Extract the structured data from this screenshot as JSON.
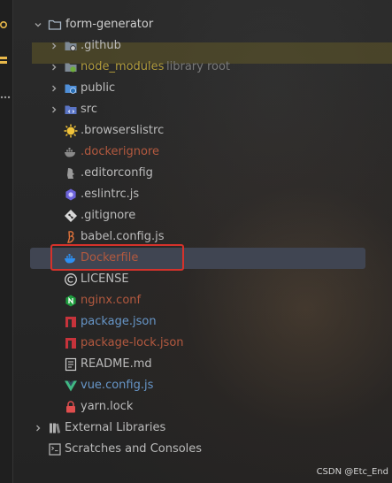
{
  "tree": {
    "root": {
      "label": "form-generator"
    },
    "items": [
      {
        "label": "",
        "detail": ""
      },
      {
        "label": ".github"
      },
      {
        "label": "node_modules",
        "detail": "library root"
      },
      {
        "label": "public"
      },
      {
        "label": "src"
      },
      {
        "label": ".browserslistrc"
      },
      {
        "label": ".dockerignore"
      },
      {
        "label": ".editorconfig"
      },
      {
        "label": ".eslintrc.js"
      },
      {
        "label": ".gitignore"
      },
      {
        "label": "babel.config.js"
      },
      {
        "label": "Dockerfile"
      },
      {
        "label": "LICENSE"
      },
      {
        "label": "nginx.conf"
      },
      {
        "label": "package.json"
      },
      {
        "label": "package-lock.json"
      },
      {
        "label": "README.md"
      },
      {
        "label": "vue.config.js"
      },
      {
        "label": "yarn.lock"
      },
      {
        "label": "External Libraries"
      },
      {
        "label": "Scratches and Consoles"
      }
    ]
  },
  "colors": {
    "default_text": "#bbbbbb",
    "ignored_text": "#b3593f",
    "modified_text": "#6796c8",
    "library_text": "#b39d3a",
    "selected_row": "#404552",
    "highlight_box": "#d6322b"
  },
  "watermark": "CSDN @Etc_End"
}
